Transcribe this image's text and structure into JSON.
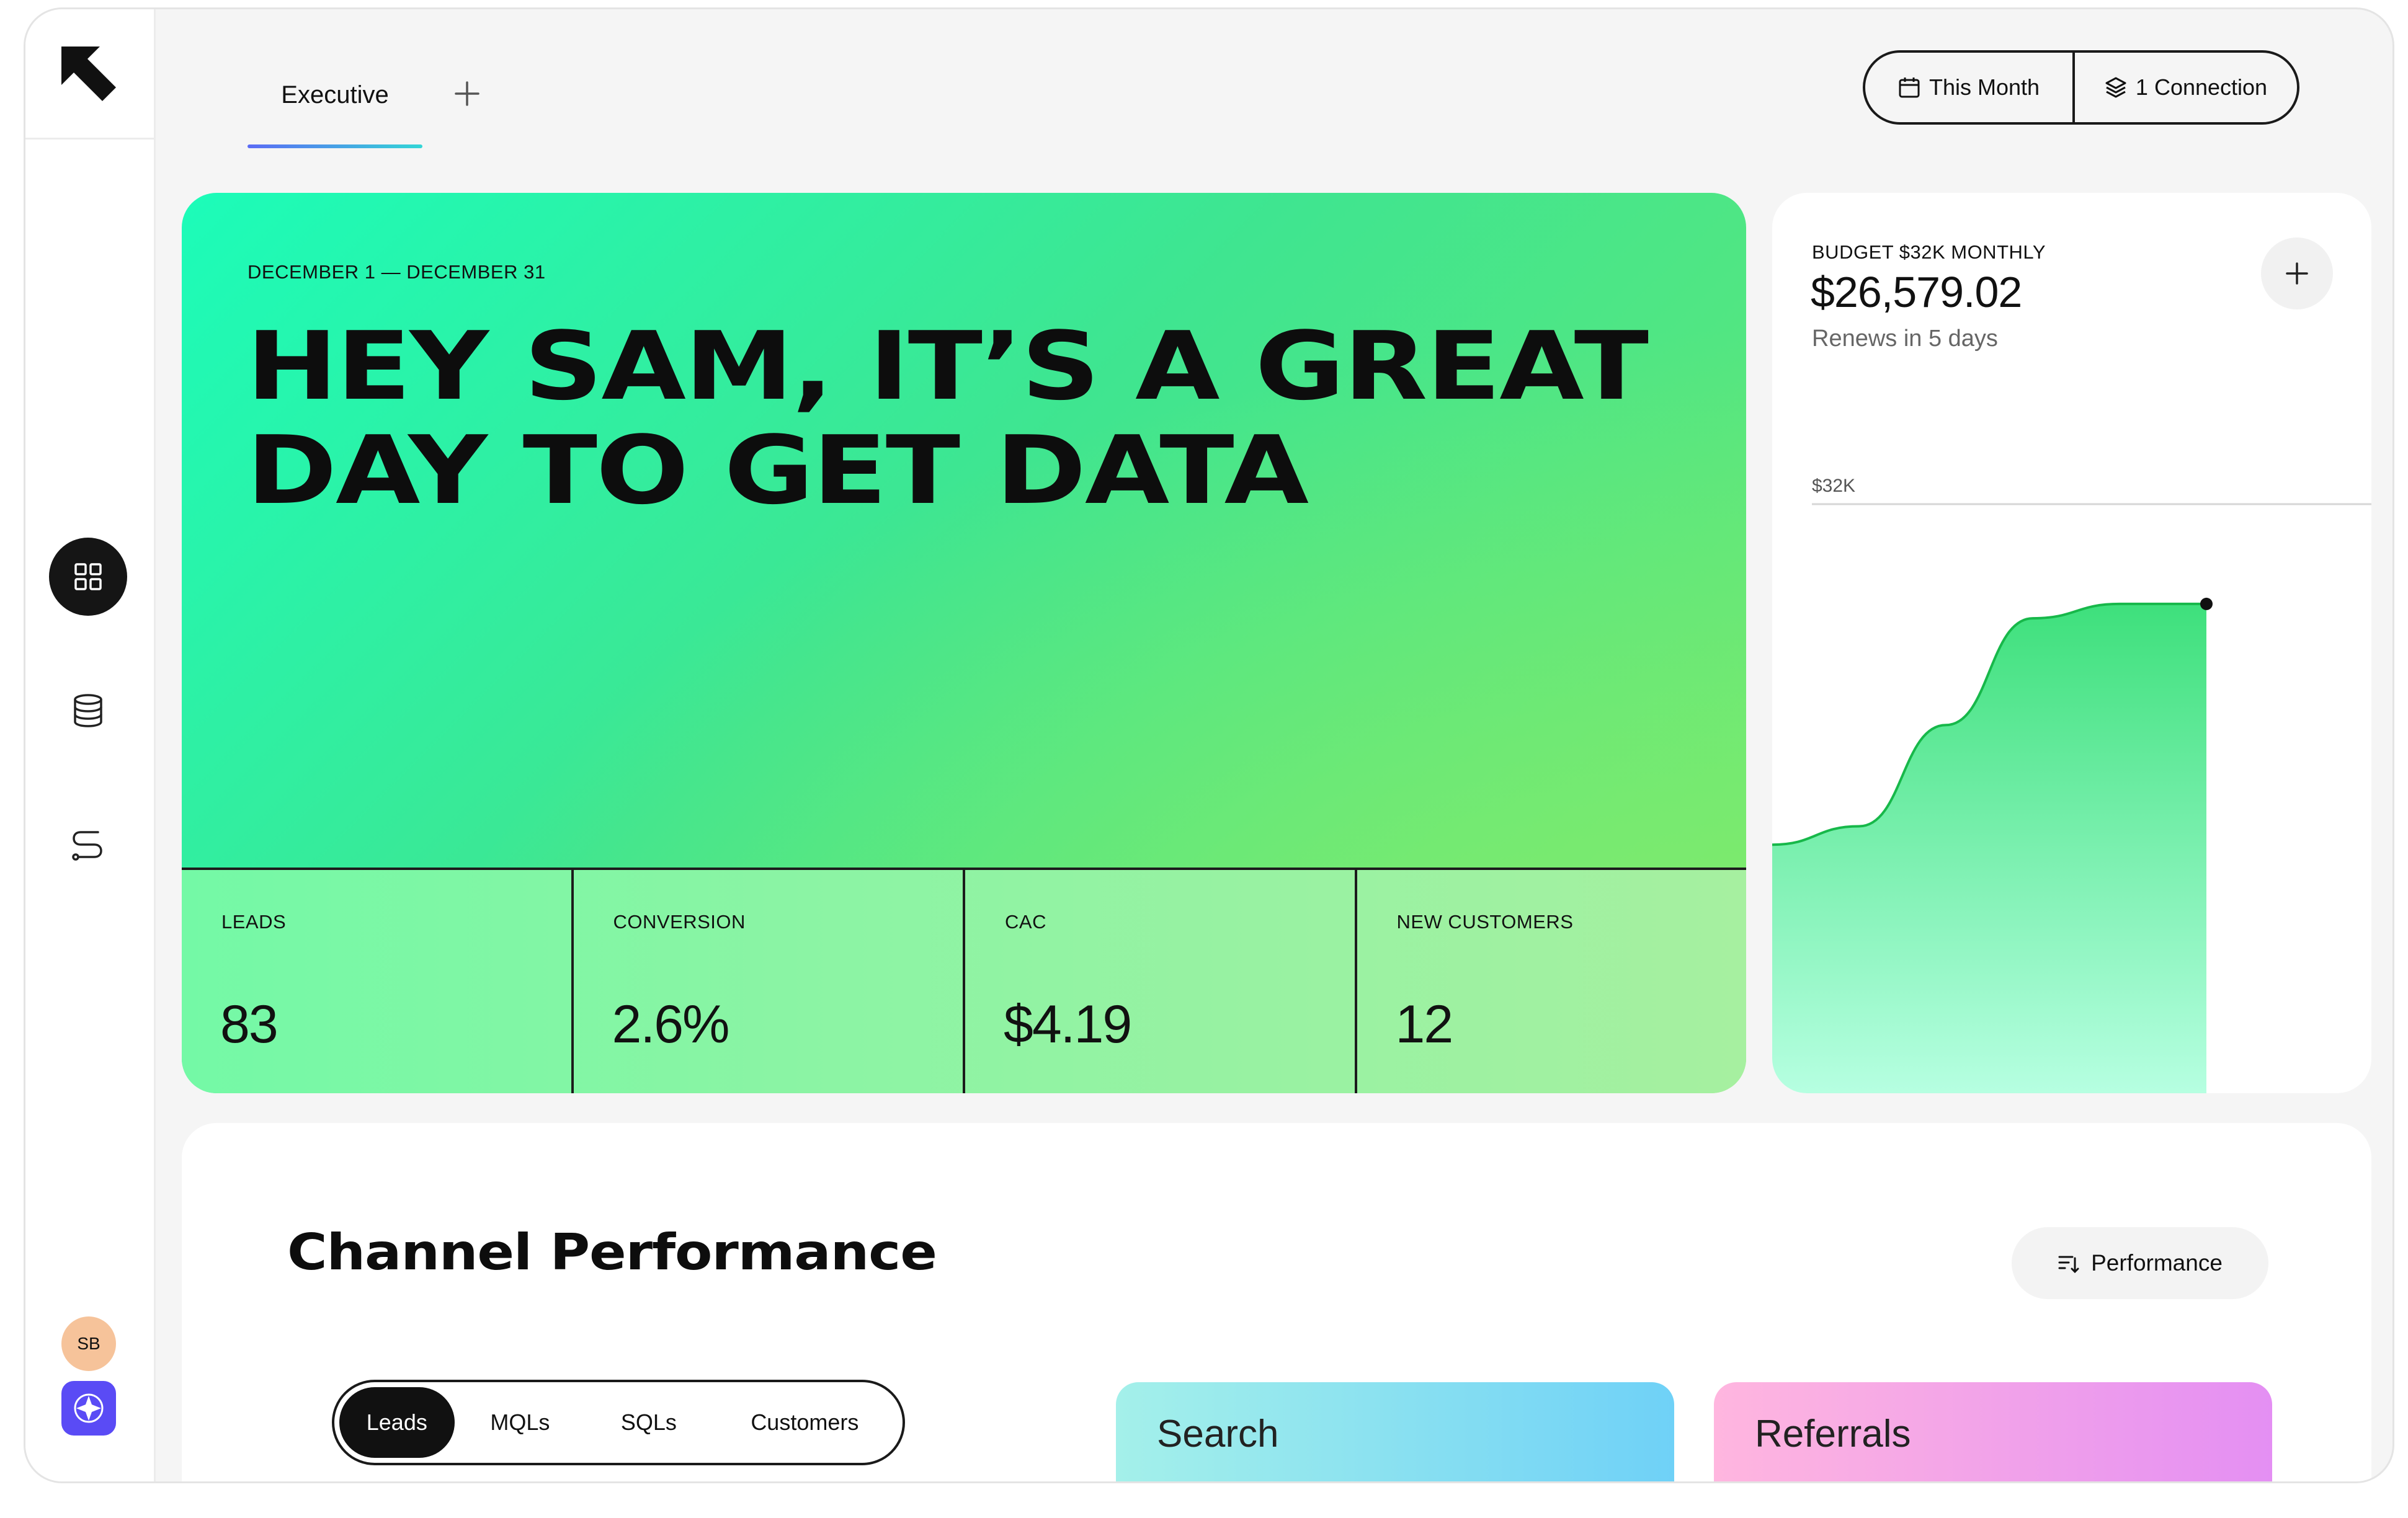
{
  "app": {
    "user_initials": "SB"
  },
  "sidebar": {
    "items": [
      {
        "icon": "grid-icon",
        "active": true
      },
      {
        "icon": "database-icon",
        "active": false
      },
      {
        "icon": "route-icon",
        "active": false
      }
    ]
  },
  "header": {
    "tabs": [
      {
        "label": "Executive",
        "active": true
      }
    ],
    "date_filter_label": "This Month",
    "connection_label": "1 Connection"
  },
  "hero": {
    "date_range": "DECEMBER 1 — DECEMBER 31",
    "title_line1": "HEY SAM, IT’S A GREAT",
    "title_line2": "DAY TO GET DATA",
    "stats": [
      {
        "label": "LEADS",
        "value": "83"
      },
      {
        "label": "CONVERSION",
        "value": "2.6%"
      },
      {
        "label": "CAC",
        "value": "$4.19"
      },
      {
        "label": "NEW CUSTOMERS",
        "value": "12"
      }
    ],
    "colors": {
      "gradient_start": "#1cfcb9",
      "gradient_end": "#86ec6b"
    }
  },
  "budget": {
    "label": "BUDGET $32K MONTHLY",
    "amount": "$26,579.02",
    "renews": "Renews in 5 days",
    "axis_label": "$32K"
  },
  "chart_data": {
    "type": "area",
    "ylim": [
      0,
      32000
    ],
    "x": [
      0,
      0.2,
      0.4,
      0.6,
      0.8,
      1.0
    ],
    "values": [
      13500,
      14500,
      20000,
      25800,
      26579.02,
      26579.02
    ],
    "threshold": 32000,
    "grid": false
  },
  "channel": {
    "title": "Channel Performance",
    "sort_label": "Performance",
    "segments": [
      "Leads",
      "MQLs",
      "SQLs",
      "Customers"
    ],
    "active_segment": "Leads",
    "cards": [
      {
        "label": "Search",
        "color_start": "#a4f0ea",
        "color_end": "#6fd1f7"
      },
      {
        "label": "Referrals",
        "color_start": "#ffb6df",
        "color_end": "#e48ff3"
      }
    ]
  }
}
